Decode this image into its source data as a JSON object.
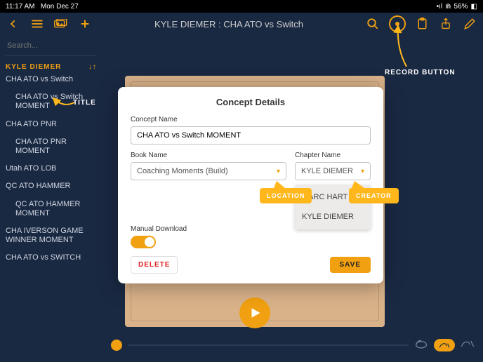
{
  "status": {
    "time": "11:17 AM",
    "date": "Mon Dec 27",
    "battery": "56%",
    "battery_icon": "◧",
    "headphone_icon": "⋒",
    "signal_icon": "•ıl"
  },
  "header": {
    "title": "KYLE DIEMER : CHA ATO vs Switch",
    "icons": {
      "back": "chevron-left",
      "menu": "menu",
      "card": "media-card",
      "add": "plus",
      "search": "magnify",
      "record": "record",
      "clipboard": "clipboard",
      "share": "share",
      "edit": "pencil"
    }
  },
  "sidebar": {
    "search_placeholder": "Search...",
    "chevron": "›",
    "section_name": "KYLE DIEMER",
    "sort_icon": "↓↑",
    "items": [
      {
        "label": "CHA ATO vs Switch",
        "sub": false
      },
      {
        "label": "CHA ATO vs Switch MOMENT",
        "sub": true
      },
      {
        "label": "CHA ATO PNR",
        "sub": false
      },
      {
        "label": "CHA ATO PNR MOMENT",
        "sub": true
      },
      {
        "label": "Utah ATO LOB",
        "sub": false
      },
      {
        "label": "QC ATO HAMMER",
        "sub": false
      },
      {
        "label": "QC ATO HAMMER MOMENT",
        "sub": true
      },
      {
        "label": "CHA IVERSON GAME WINNER MOMENT",
        "sub": false
      },
      {
        "label": "CHA ATO vs SWITCH",
        "sub": false
      }
    ]
  },
  "modal": {
    "title": "Concept Details",
    "concept_label": "Concept Name",
    "concept_value": "CHA ATO vs Switch MOMENT",
    "book_label": "Book Name",
    "book_value": "Coaching Moments (Build)",
    "chapter_label": "Chapter Name",
    "chapter_value": "KYLE DIEMER",
    "chapter_options": [
      "MARC HART",
      "KYLE DIEMER"
    ],
    "manual_dl_label": "Manual Download",
    "delete_label": "DELETE",
    "save_label": "SAVE"
  },
  "annotations": {
    "title": "TITLE",
    "location": "LOCATION",
    "creator": "CREATOR",
    "record": "RECORD BUTTON"
  }
}
